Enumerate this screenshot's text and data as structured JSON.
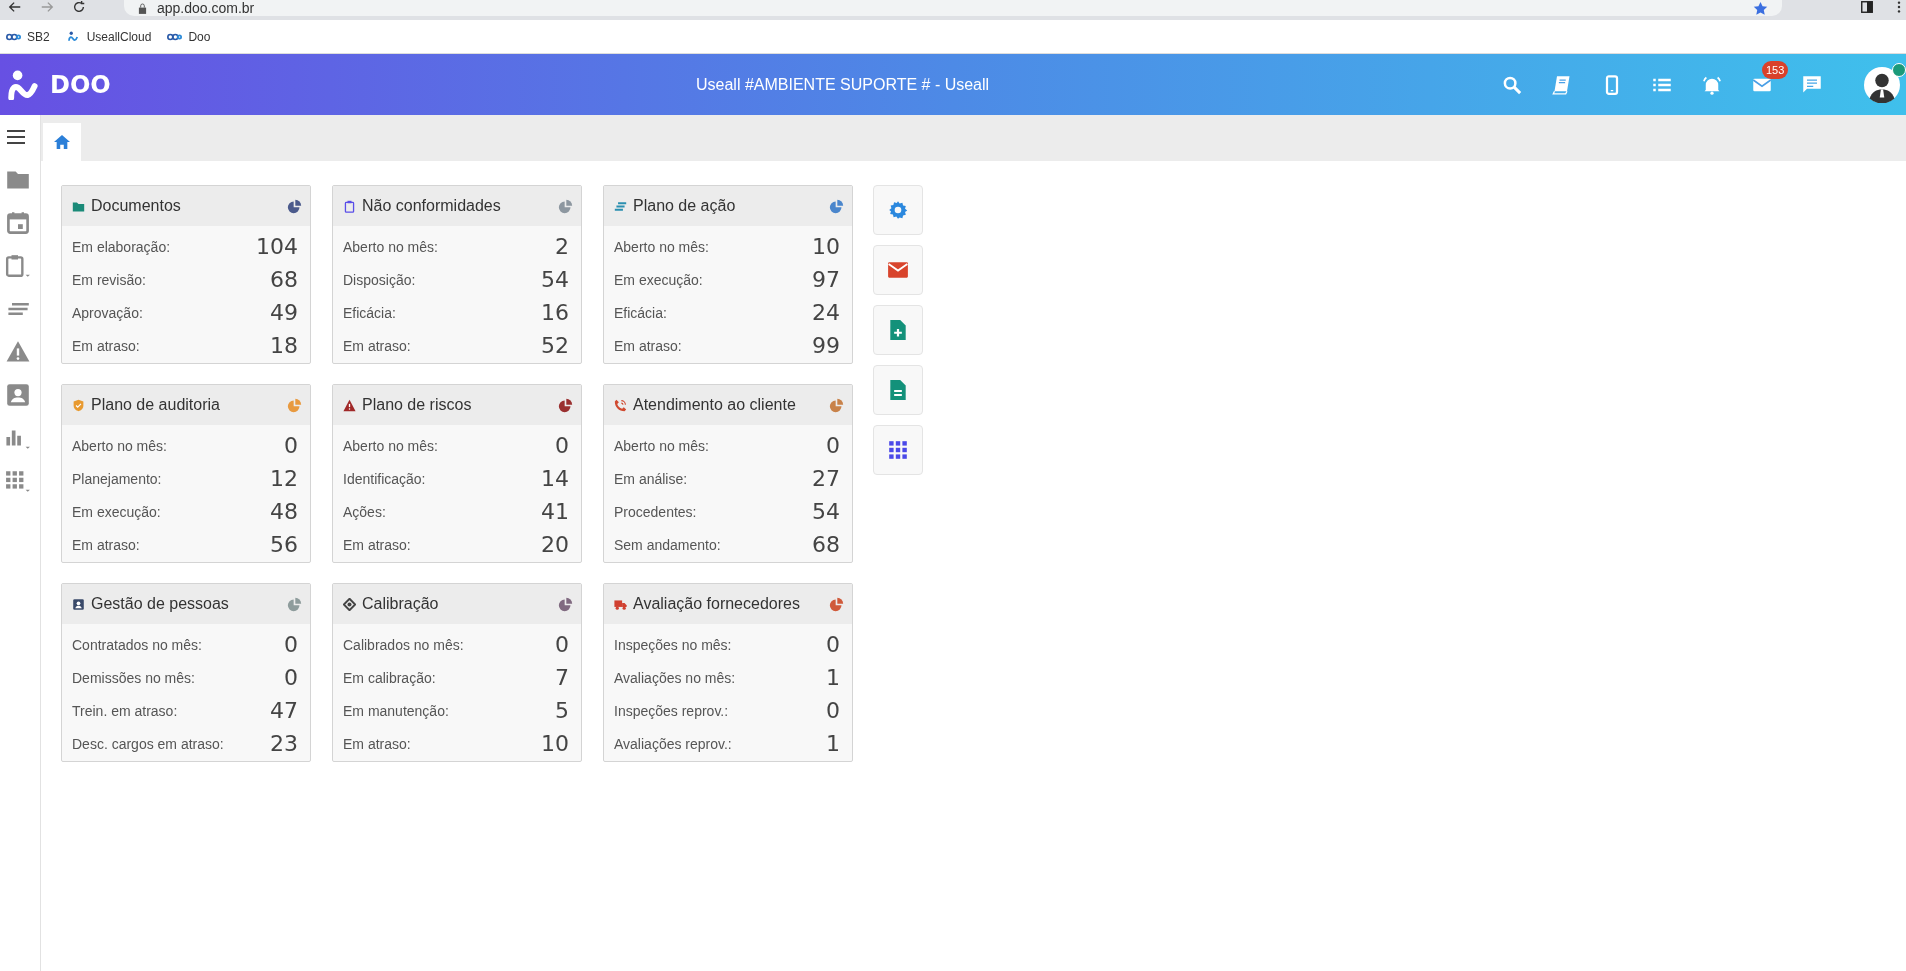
{
  "browser": {
    "url": "app.doo.com.br",
    "bookmarks": [
      {
        "label": "SB2",
        "kind": "doo"
      },
      {
        "label": "UseallCloud",
        "kind": "useall"
      },
      {
        "label": "Doo",
        "kind": "doo"
      }
    ]
  },
  "header": {
    "logo": "DOO",
    "title": "Useall #AMBIENTE SUPORTE # - Useall",
    "mail_badge": "153"
  },
  "cards": [
    {
      "title": "Documentos",
      "kind": "folder",
      "color": "#1a8a78",
      "chart_icon": {
        "color": "#4b5a8c"
      },
      "rows": [
        {
          "label": "Em elaboração:",
          "value": "104"
        },
        {
          "label": "Em revisão:",
          "value": "68"
        },
        {
          "label": "Aprovação:",
          "value": "49"
        },
        {
          "label": "Em atraso:",
          "value": "18"
        }
      ]
    },
    {
      "title": "Não conformidades",
      "kind": "clipboard",
      "color": "#5a4ee8",
      "chart_icon": {
        "color": "#8d97a0"
      },
      "rows": [
        {
          "label": "Aberto no mês:",
          "value": "2"
        },
        {
          "label": "Disposição:",
          "value": "54"
        },
        {
          "label": "Eficácia:",
          "value": "16"
        },
        {
          "label": "Em atraso:",
          "value": "52"
        }
      ]
    },
    {
      "title": "Plano de ação",
      "kind": "lines",
      "color": "#2a8fb0",
      "chart_icon": {
        "color": "#4a86cc"
      },
      "rows": [
        {
          "label": "Aberto no mês:",
          "value": "10"
        },
        {
          "label": "Em execução:",
          "value": "97"
        },
        {
          "label": "Eficácia:",
          "value": "24"
        },
        {
          "label": "Em atraso:",
          "value": "99"
        }
      ]
    },
    {
      "title": "Plano de auditoria",
      "kind": "shield",
      "color": "#e89a30",
      "chart_icon": {
        "color": "#e89a40"
      },
      "rows": [
        {
          "label": "Aberto no mês:",
          "value": "0"
        },
        {
          "label": "Planejamento:",
          "value": "12"
        },
        {
          "label": "Em execução:",
          "value": "48"
        },
        {
          "label": "Em atraso:",
          "value": "56"
        }
      ]
    },
    {
      "title": "Plano de riscos",
      "kind": "warning",
      "color": "#a02828",
      "chart_icon": {
        "color": "#9a3030"
      },
      "rows": [
        {
          "label": "Aberto no mês:",
          "value": "0"
        },
        {
          "label": "Identificação:",
          "value": "14"
        },
        {
          "label": "Ações:",
          "value": "41"
        },
        {
          "label": "Em atraso:",
          "value": "20"
        }
      ]
    },
    {
      "title": "Atendimento ao cliente",
      "kind": "phone",
      "color": "#d04a30",
      "chart_icon": {
        "color": "#c8824a"
      },
      "rows": [
        {
          "label": "Aberto no mês:",
          "value": "0"
        },
        {
          "label": "Em análise:",
          "value": "27"
        },
        {
          "label": "Procedentes:",
          "value": "54"
        },
        {
          "label": "Sem andamento:",
          "value": "68"
        }
      ]
    },
    {
      "title": "Gestão de pessoas",
      "kind": "person",
      "color": "#3a4a6a",
      "chart_icon": {
        "color": "#8e9c9c"
      },
      "rows": [
        {
          "label": "Contratados no mês:",
          "value": "0"
        },
        {
          "label": "Demissões no mês:",
          "value": "0"
        },
        {
          "label": "Trein. em atraso:",
          "value": "47"
        },
        {
          "label": "Desc. cargos em atraso:",
          "value": "23"
        }
      ]
    },
    {
      "title": "Calibração",
      "kind": "target",
      "color": "#444444",
      "chart_icon": {
        "color": "#806a80"
      },
      "rows": [
        {
          "label": "Calibrados no mês:",
          "value": "0"
        },
        {
          "label": "Em calibração:",
          "value": "7"
        },
        {
          "label": "Em manutenção:",
          "value": "5"
        },
        {
          "label": "Em atraso:",
          "value": "10"
        }
      ]
    },
    {
      "title": "Avaliação fornecedores",
      "kind": "truck",
      "color": "#d04030",
      "chart_icon": {
        "color": "#d05a3a"
      },
      "rows": [
        {
          "label": "Inspeções no mês:",
          "value": "0"
        },
        {
          "label": "Avaliações no mês:",
          "value": "1"
        },
        {
          "label": "Inspeções reprov.:",
          "value": "0"
        },
        {
          "label": "Avaliações reprov.:",
          "value": "1"
        }
      ]
    }
  ]
}
